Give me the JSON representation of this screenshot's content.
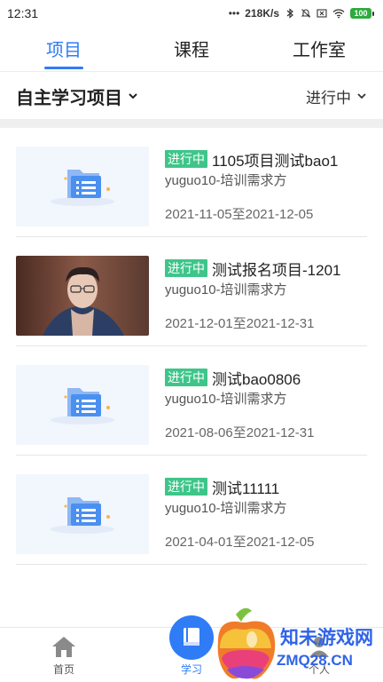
{
  "status_bar": {
    "time": "12:31",
    "network_speed": "218K/s",
    "battery": "100"
  },
  "top_tabs": [
    {
      "label": "项目",
      "active": true
    },
    {
      "label": "课程",
      "active": false
    },
    {
      "label": "工作室",
      "active": false
    }
  ],
  "filter": {
    "category": "自主学习项目",
    "status": "进行中"
  },
  "projects": [
    {
      "badge": "进行中",
      "title": "1105项目测试bao1",
      "org": "yuguo10-培训需求方",
      "date_range": "2021-11-05至2021-12-05",
      "thumb": "folder-placeholder"
    },
    {
      "badge": "进行中",
      "title": "测试报名项目-1201",
      "org": "yuguo10-培训需求方",
      "date_range": "2021-12-01至2021-12-31",
      "thumb": "photo-man-glasses"
    },
    {
      "badge": "进行中",
      "title": "测试bao0806",
      "org": "yuguo10-培训需求方",
      "date_range": "2021-08-06至2021-12-31",
      "thumb": "folder-placeholder"
    },
    {
      "badge": "进行中",
      "title": "测试11111",
      "org": "yuguo10-培训需求方",
      "date_range": "2021-04-01至2021-12-05",
      "thumb": "folder-placeholder"
    }
  ],
  "bottom_nav": [
    {
      "label": "首页",
      "icon": "home-icon",
      "active": false
    },
    {
      "label": "学习",
      "icon": "book-icon",
      "active": true
    },
    {
      "label": "个人",
      "icon": "person-icon",
      "active": false
    }
  ],
  "watermark": {
    "line1": "知未游戏网",
    "line2": "ZMQ28.CN"
  },
  "colors": {
    "accent": "#2f7cf6",
    "badge": "#3fc58a",
    "watermark": "#2f64e8"
  }
}
